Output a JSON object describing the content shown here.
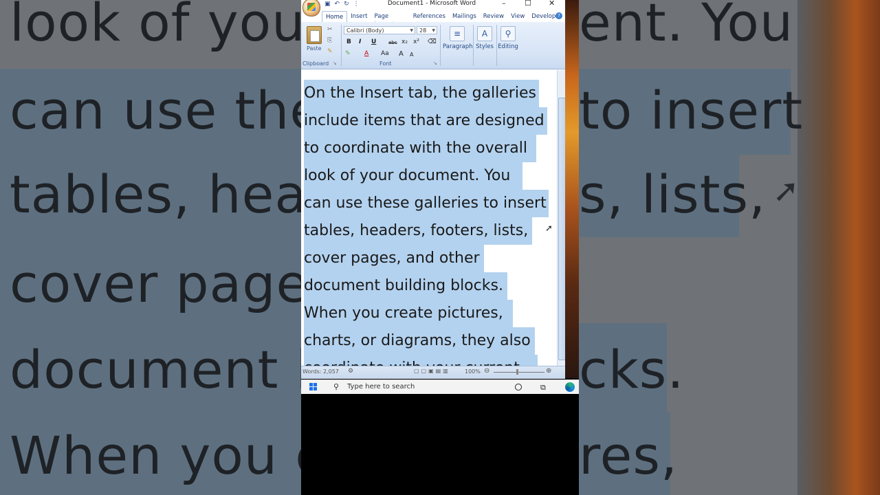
{
  "background": {
    "lines": [
      "look of your",
      "can use these",
      "tables, head",
      "cover pages",
      "document b",
      "When you c"
    ],
    "right_fragments": [
      "ent. You",
      "to insert",
      "s, lists,",
      "",
      "cks.",
      "res,"
    ]
  },
  "window": {
    "title": "Document1 - Microsoft Word",
    "minimize": "–",
    "maximize": "☐",
    "close": "✕",
    "qat": {
      "save": "▣",
      "undo": "↶",
      "redo": "↻",
      "more": "⋮"
    }
  },
  "tabs": [
    "Home",
    "Insert",
    "Page Layout",
    "References",
    "Mailings",
    "Review",
    "View",
    "Developer"
  ],
  "ribbon": {
    "paste_label": "Paste",
    "clipboard_label": "Clipboard",
    "font_label": "Font",
    "font_name": "Calibri (Body)",
    "font_size": "28",
    "bold": "B",
    "italic": "I",
    "underline": "U",
    "strikethrough": "abc",
    "subscript": "x₂",
    "superscript": "x²",
    "font_color": "A",
    "change_case": "Aa",
    "grow_font": "A",
    "shrink_font": "A",
    "paragraph_label": "Paragraph",
    "styles_label": "Styles",
    "editing_label": "Editing"
  },
  "document": {
    "lines": [
      "On the Insert tab, the galleries",
      "include items that are designed",
      "to coordinate with the overall",
      "look of your document. You",
      "can use these galleries to insert",
      "tables, headers, footers, lists,",
      "cover pages, and other",
      "document building blocks.",
      "When you create pictures,",
      "charts, or diagrams, they also",
      "coordinate with your current"
    ]
  },
  "status": {
    "words": "Words: 2,057",
    "zoom": "100%"
  },
  "taskbar": {
    "search_placeholder": "Type here to search"
  }
}
